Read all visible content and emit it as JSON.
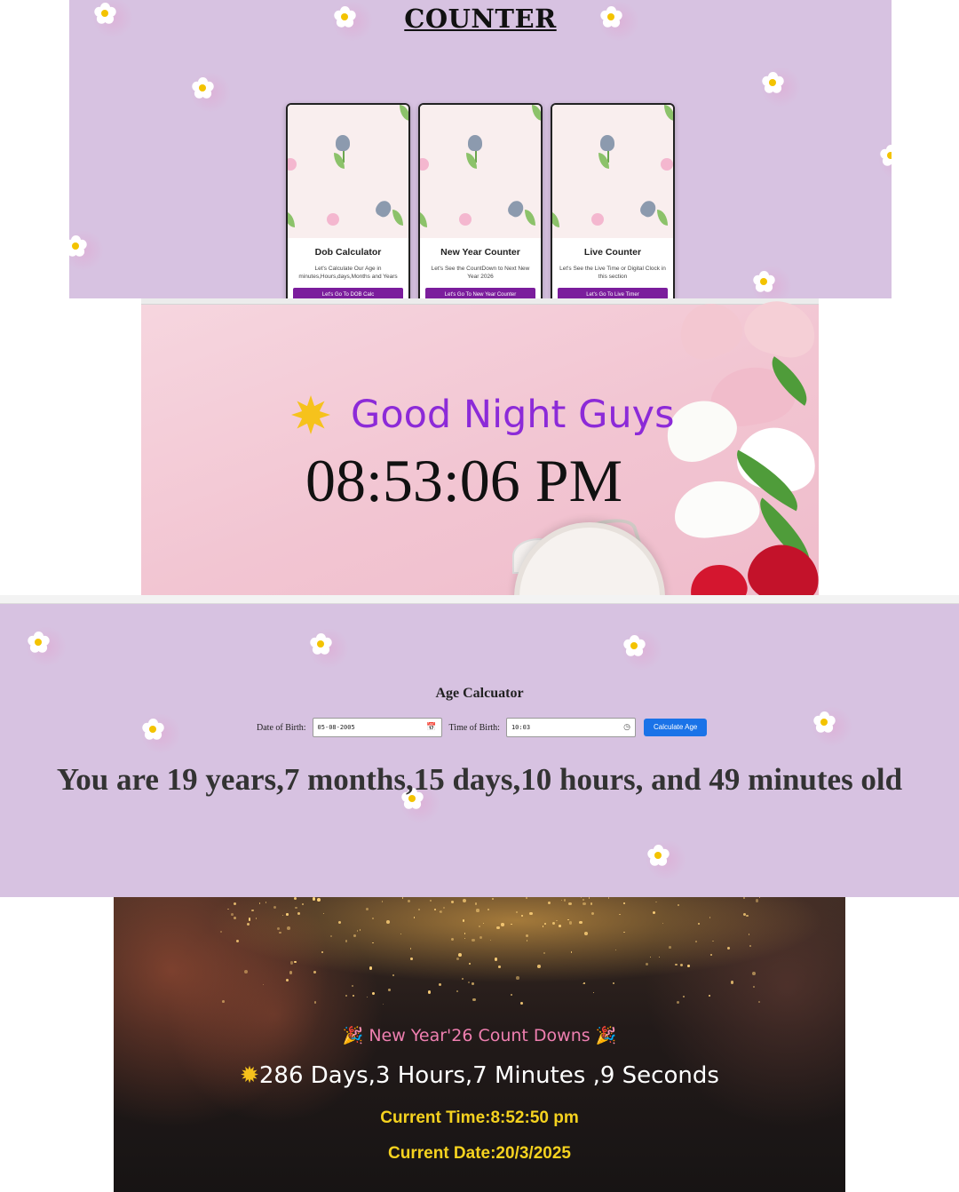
{
  "landing": {
    "title": "COUNTER",
    "cards": [
      {
        "title": "Dob Calculator",
        "description": "Let's Calculate Our Age in minutes,Hours,days,Months and Years",
        "button": "Let's Go To DOB Calc"
      },
      {
        "title": "New Year Counter",
        "description": "Let's See the CountDown to Next New Year 2026",
        "button": "Let's Go To New Year Counter"
      },
      {
        "title": "Live Counter",
        "description": "Let's See the Live Time or Digital Clock in this section",
        "button": "Let's Go To Live Timer"
      }
    ]
  },
  "clock": {
    "icon": "sun-emoji-icon",
    "greeting": "Good Night Guys",
    "time": "08:53:06 PM"
  },
  "age": {
    "title": "Age Calcuator",
    "dob_label": "Date of Birth:",
    "dob_value": "05-08-2005",
    "tob_label": "Time of Birth:",
    "tob_value": "10:03",
    "button": "Calculate Age",
    "result": "You are 19 years,7 months,15 days,10 hours, and 49 minutes old"
  },
  "newyear": {
    "title": "New Year'26 Count Downs",
    "countdown": "286 Days,3 Hours,7 Minutes ,9 Seconds",
    "current_time": "Current Time:8:52:50 pm",
    "current_date": "Current Date:20/3/2025"
  },
  "colors": {
    "lavender": "#d7c2e1",
    "greeting_purple": "#8c2ad8",
    "button_purple": "#7b1d9c",
    "button_blue": "#1a73e8",
    "newyear_pink": "#ef7fb0",
    "newyear_yellow": "#f5d21f"
  }
}
